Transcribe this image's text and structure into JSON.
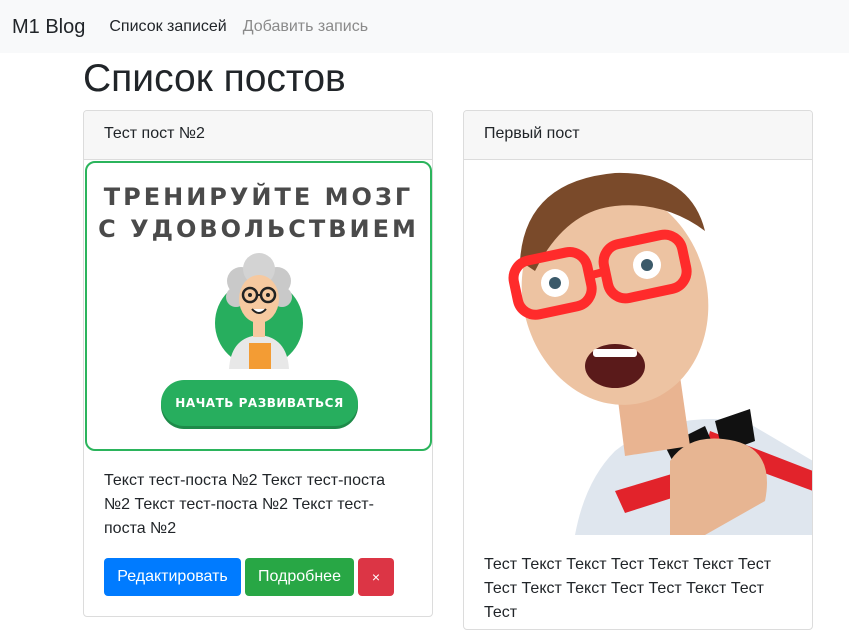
{
  "navbar": {
    "brand": "M1 Blog",
    "links": [
      {
        "label": "Список записей"
      },
      {
        "label": "Добавить запись"
      }
    ]
  },
  "page": {
    "title": "Список постов"
  },
  "posts": [
    {
      "title": "Тест пост №2",
      "image": {
        "headline_line1": "ТРЕНИРУЙТЕ МОЗГ",
        "headline_line2": "С УДОВОЛЬСТВИЕМ",
        "button_label": "НАЧАТЬ РАЗВИВАТЬСЯ",
        "accent_color": "#27ae5e"
      },
      "text": "Текст тест-поста №2 Текст тест-поста №2 Текст тест-поста №2 Текст тест-поста №2",
      "buttons": {
        "edit": "Редактировать",
        "details": "Подробнее",
        "delete": "×"
      }
    },
    {
      "title": "Первый пост",
      "image": {
        "description_icon": "surprised-man-photo"
      },
      "text": "Тест Текст Текст Тест Текст Текст Тест Тест Текст Текст Тест Тест Текст Тест Тест"
    }
  ],
  "colors": {
    "primary": "#007bff",
    "success": "#28a745",
    "danger": "#dc3545",
    "navbar_bg": "#f8f9fa"
  }
}
